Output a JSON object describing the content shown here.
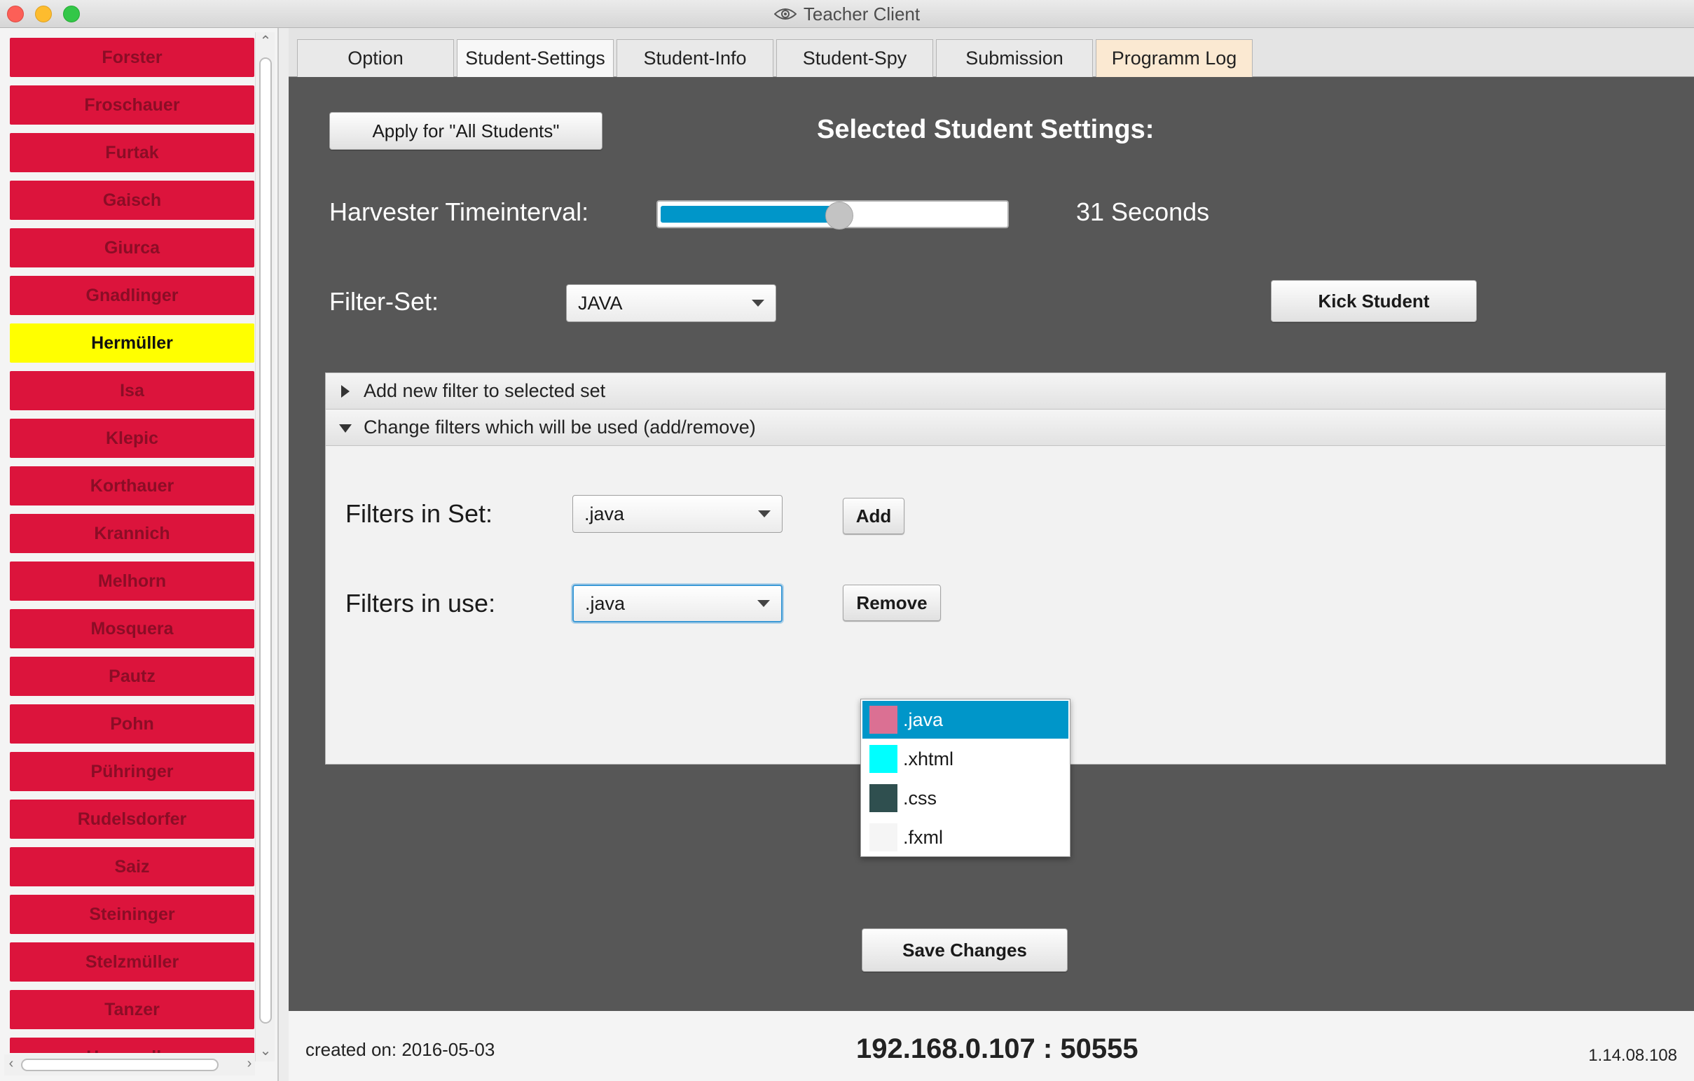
{
  "window": {
    "title": "Teacher Client"
  },
  "students": [
    {
      "name": "Forster",
      "selected": false
    },
    {
      "name": "Froschauer",
      "selected": false
    },
    {
      "name": "Furtak",
      "selected": false
    },
    {
      "name": "Gaisch",
      "selected": false
    },
    {
      "name": "Giurca",
      "selected": false
    },
    {
      "name": "Gnadlinger",
      "selected": false
    },
    {
      "name": "Hermüller",
      "selected": true
    },
    {
      "name": "Isa",
      "selected": false
    },
    {
      "name": "Klepic",
      "selected": false
    },
    {
      "name": "Korthauer",
      "selected": false
    },
    {
      "name": "Krannich",
      "selected": false
    },
    {
      "name": "Melhorn",
      "selected": false
    },
    {
      "name": "Mosquera",
      "selected": false
    },
    {
      "name": "Pautz",
      "selected": false
    },
    {
      "name": "Pohn",
      "selected": false
    },
    {
      "name": "Pühringer",
      "selected": false
    },
    {
      "name": "Rudelsdorfer",
      "selected": false
    },
    {
      "name": "Saiz",
      "selected": false
    },
    {
      "name": "Steininger",
      "selected": false
    },
    {
      "name": "Stelzmüller",
      "selected": false
    },
    {
      "name": "Tanzer",
      "selected": false
    },
    {
      "name": "Hermueller",
      "selected": false
    }
  ],
  "tabs": [
    {
      "label": "Option"
    },
    {
      "label": "Student-Settings"
    },
    {
      "label": "Student-Info"
    },
    {
      "label": "Student-Spy"
    },
    {
      "label": "Submission"
    },
    {
      "label": "Programm Log"
    }
  ],
  "active_tab": "Student-Settings",
  "settings": {
    "apply_all_label": "Apply for \"All Students\"",
    "heading": "Selected Student Settings:",
    "harvester_label": "Harvester Timeinterval:",
    "harvester_value_text": "31 Seconds",
    "harvester_slider_fraction": 0.52,
    "filterset_label": "Filter-Set:",
    "filterset_value": "JAVA",
    "kick_label": "Kick Student",
    "save_label": "Save Changes"
  },
  "accordion": {
    "add_filter_title": "Add new filter to selected set",
    "change_filters_title": "Change filters which will be used (add/remove)",
    "filters_in_set_label": "Filters in Set:",
    "filters_in_set_value": ".java",
    "add_label": "Add",
    "filters_in_use_label": "Filters in use:",
    "filters_in_use_value": ".java",
    "remove_label": "Remove",
    "dropdown_options": [
      {
        "label": ".java",
        "color": "#db7093",
        "selected": true
      },
      {
        "label": ".xhtml",
        "color": "#00ffff",
        "selected": false
      },
      {
        "label": ".css",
        "color": "#2f4f4f",
        "selected": false
      },
      {
        "label": ".fxml",
        "color": "#f5f5f5",
        "selected": false
      }
    ]
  },
  "footer": {
    "created": "created on: 2016-05-03",
    "address": "192.168.0.107 : 50555",
    "version": "1.14.08.108"
  },
  "colors": {
    "student_default": "#dc143c",
    "student_selected": "#ffff00",
    "accent": "#0096c9",
    "content_bg": "#575757"
  }
}
